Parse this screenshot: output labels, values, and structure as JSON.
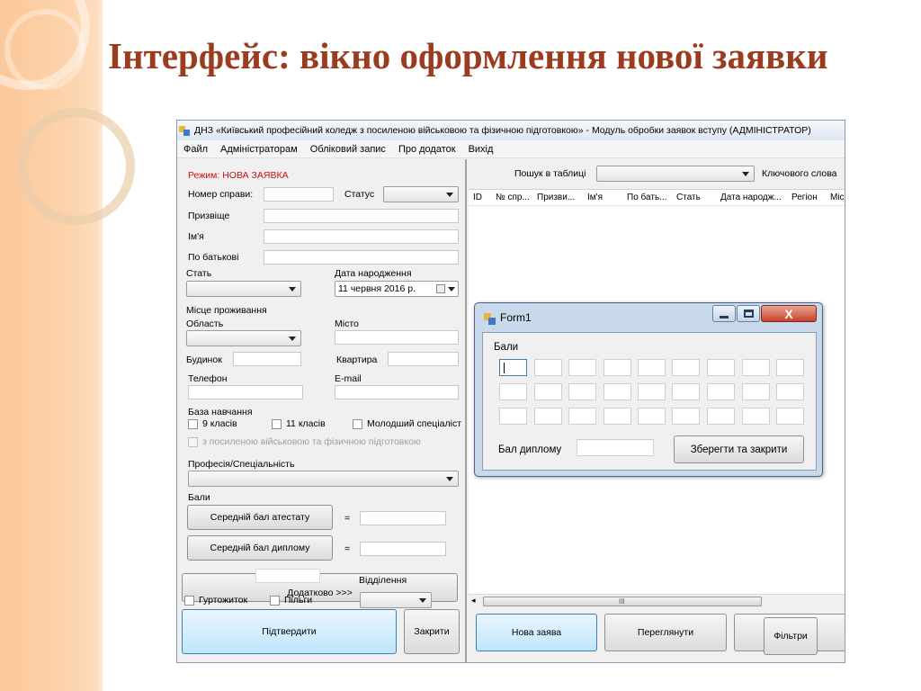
{
  "slide": {
    "title": "Інтерфейс: вікно оформлення нової заявки"
  },
  "window": {
    "title": "ДНЗ «Київський професійний коледж з посиленою військовою та фізичною підготовкою» - Модуль обробки заявок вступу (АДМІНІСТРАТОР)",
    "menu": [
      "Файл",
      "Адміністраторам",
      "Обліковий запис",
      "Про додаток",
      "Вихід"
    ]
  },
  "form": {
    "mode": "Режим: НОВА ЗАЯВКА",
    "case_number_label": "Номер справи:",
    "status_label": "Статус",
    "surname_label": "Призвіще",
    "name_label": "Ім'я",
    "patronymic_label": "По батькові",
    "sex_label": "Стать",
    "birth_label": "Дата народження",
    "birth_value": "11   червня   2016 р.",
    "residence_label": "Місце проживання",
    "region_label": "Область",
    "city_label": "Місто",
    "house_label": "Будинок",
    "apartment_label": "Квартира",
    "phone_label": "Телефон",
    "email_label": "E-mail",
    "education_label": "База навчання",
    "grade9_label": "9 класів",
    "grade11_label": "11 класів",
    "junior_label": "Молодший спеціаліст",
    "military_label": "з посиленою військовою та фізичною підготовкою",
    "profession_label": "Професія/Спеціальність",
    "scores_label": "Бали",
    "avg_certificate_button": "Середній бал атестату",
    "avg_diploma_button": "Середній бал диплому",
    "equals": "=",
    "extra_button": "Додатково >>>",
    "department_label": "Відділення",
    "dormitory_label": "Гуртожиток",
    "benefits_label": "Пільги",
    "confirm_button": "Підтвердити",
    "close_button": "Закрити"
  },
  "table": {
    "search_label": "Пошук в таблиці",
    "keyword_label": "Ключового слова",
    "columns": [
      "ID",
      "№ спр...",
      "Призви...",
      "Ім'я",
      "По бать...",
      "Стать",
      "Дата народж...",
      "Регіон",
      "Міс"
    ],
    "scroll_grip": "III",
    "scroll_left": "◂"
  },
  "bottom_buttons": {
    "new": "Нова заява",
    "view": "Переглянути",
    "filters": "Фільтри"
  },
  "dialog": {
    "title": "Form1",
    "scores_label": "Бали",
    "diploma_label": "Бал диплому",
    "save_button": "Зберегти та закрити",
    "close_glyph": "X"
  }
}
